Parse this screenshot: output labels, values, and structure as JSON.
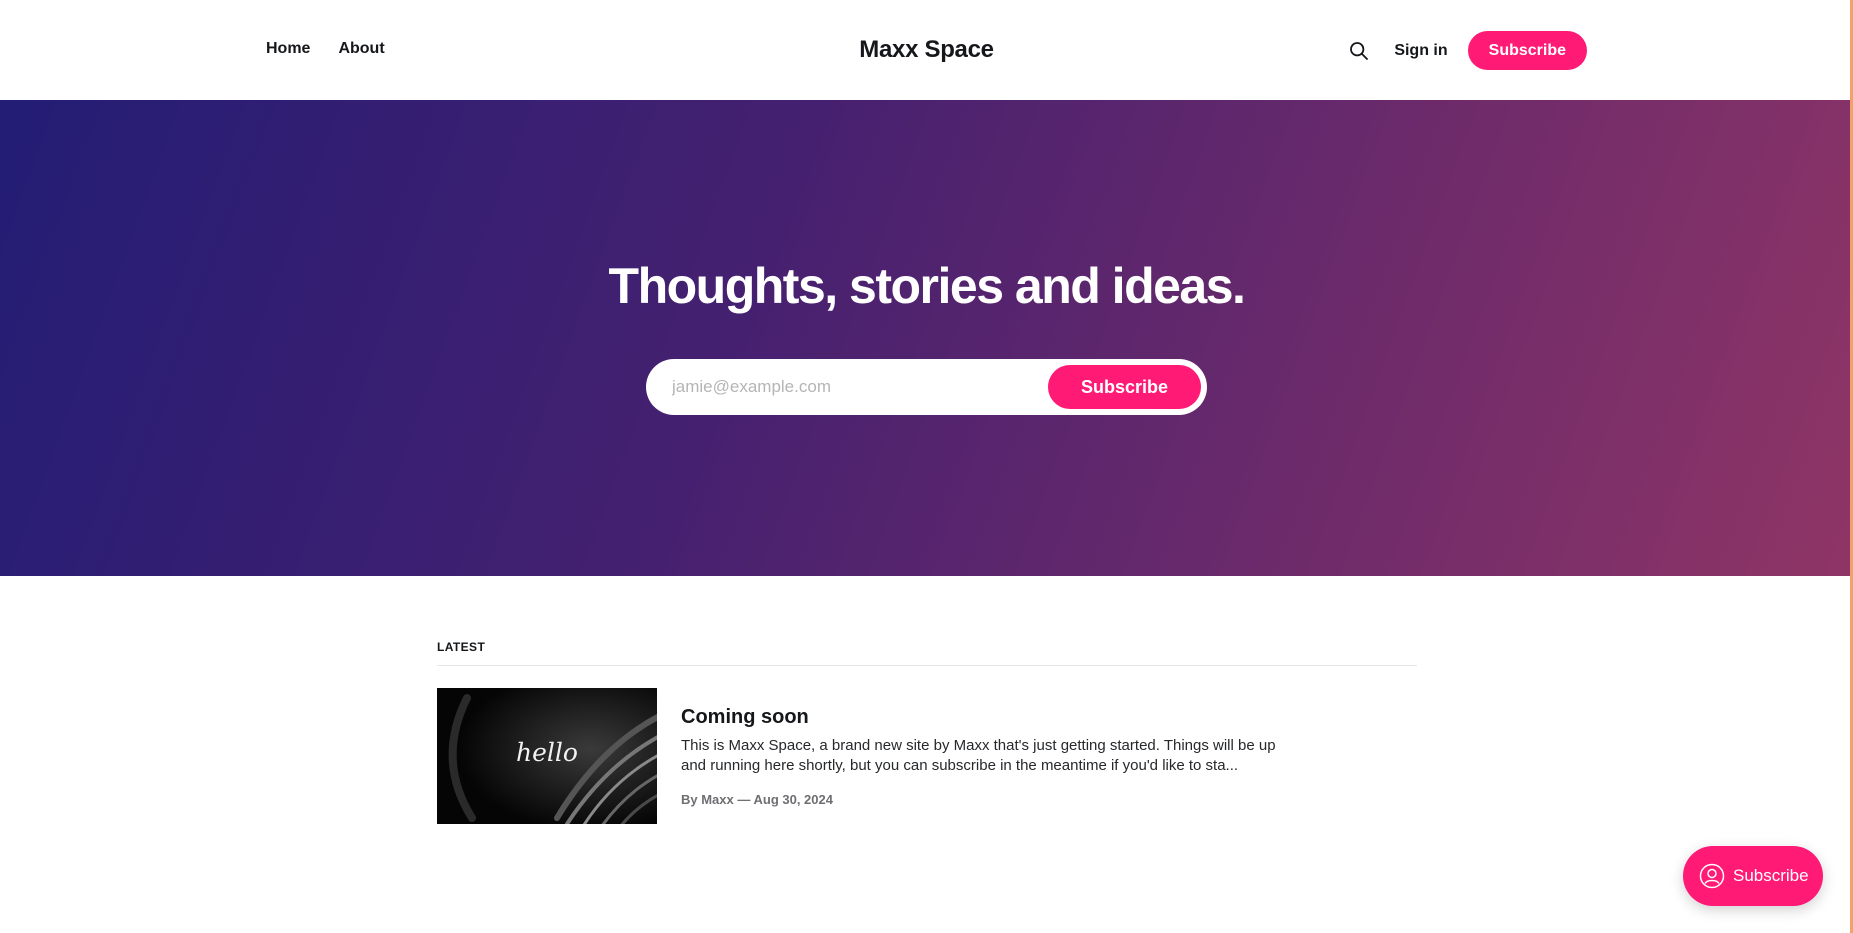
{
  "header": {
    "nav": [
      "Home",
      "About"
    ],
    "site_title": "Maxx Space",
    "search_icon": "search-icon",
    "signin_label": "Sign in",
    "subscribe_label": "Subscribe"
  },
  "hero": {
    "title": "Thoughts, stories and ideas.",
    "email_placeholder": "jamie@example.com",
    "submit_label": "Subscribe"
  },
  "feed": {
    "section_label": "LATEST",
    "posts": [
      {
        "title": "Coming soon",
        "thumbnail_text": "hello",
        "excerpt": "This is Maxx Space, a brand new site by Maxx that's just getting started. Things will be up and running here shortly, but you can subscribe in the meantime if you'd like to sta...",
        "meta": "By Maxx — Aug 30, 2024"
      }
    ]
  },
  "portal": {
    "icon": "user-icon",
    "label": "Subscribe"
  },
  "colors": {
    "accent": "#ff1a75",
    "hero_gradient_start": "#231d75",
    "hero_gradient_end": "#8f3566",
    "text": "#15171a"
  }
}
